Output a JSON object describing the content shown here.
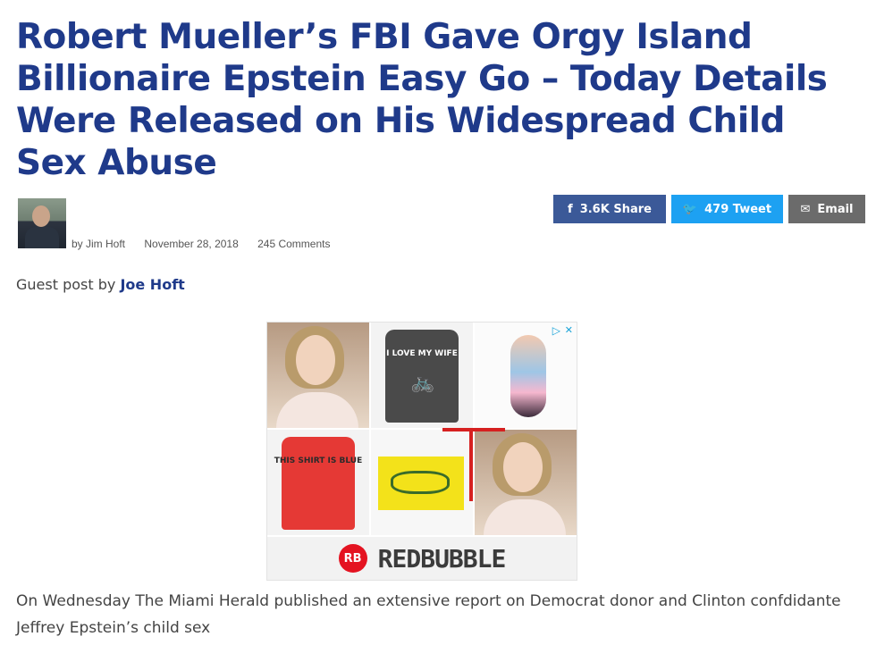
{
  "article": {
    "headline": "Robert Mueller’s FBI Gave Orgy Island Billionaire Epstein Easy Go – Today Details Were Released on His Widespread Child Sex Abuse",
    "author": "by Jim Hoft",
    "date": "November 28, 2018",
    "comments": "245 Comments",
    "guest_prefix": "Guest post by",
    "guest_author": "Joe Hoft",
    "body": "On Wednesday The Miami Herald published an extensive report on Democrat donor and Clinton confdidante Jeffrey Epstein’s child sex"
  },
  "share": {
    "facebook": {
      "icon": "facebook-icon",
      "label": "3.6K Share",
      "color": "#3b5998"
    },
    "twitter": {
      "icon": "twitter-icon",
      "label": "479 Tweet",
      "color": "#1da1f2"
    },
    "email": {
      "icon": "mail-icon",
      "label": "Email",
      "color": "#6b6b6b"
    }
  },
  "ad": {
    "tiles": [
      {
        "kind": "model-photo"
      },
      {
        "kind": "tshirt",
        "text": "I LOVE MY WIFE"
      },
      {
        "kind": "illustration"
      },
      {
        "kind": "tshirt",
        "text": "THIS SHIRT IS BLUE"
      },
      {
        "kind": "flag"
      },
      {
        "kind": "model-photo"
      }
    ],
    "brand_logo": "RB",
    "brand_name": "REDBUBBLE",
    "adchoices_icon": "adchoices-icon",
    "close_icon": "close-icon",
    "brand_color": "#e41321"
  }
}
